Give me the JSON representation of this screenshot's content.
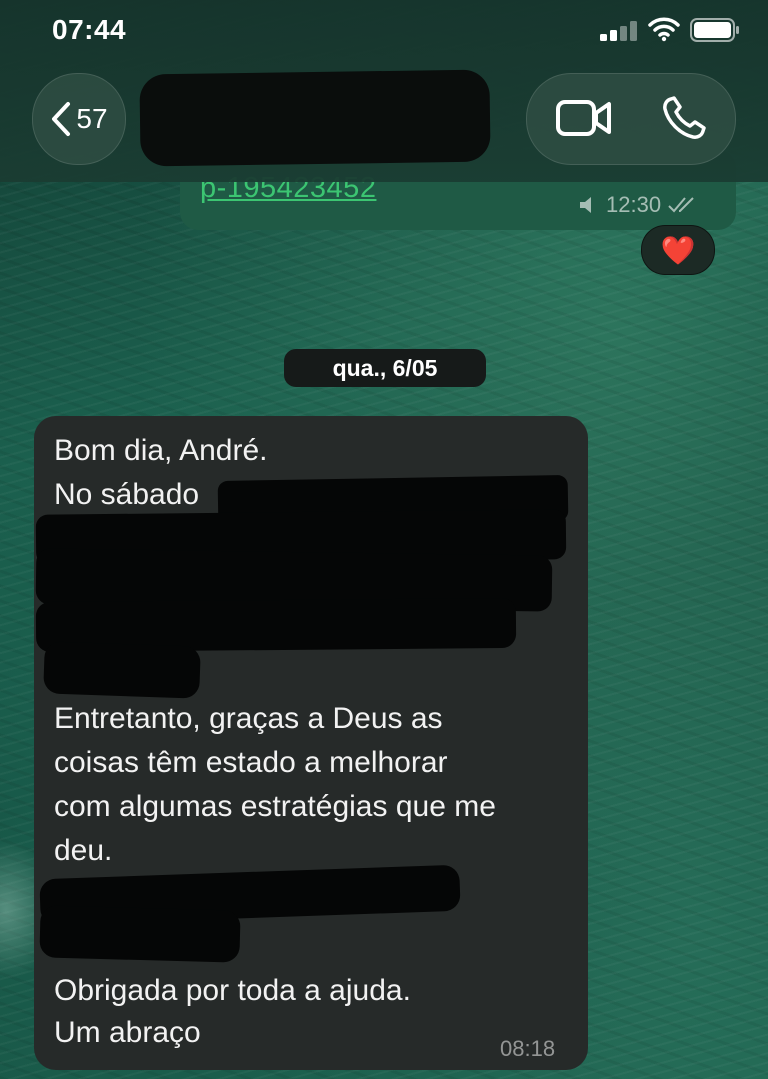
{
  "status_bar": {
    "time": "07:44"
  },
  "header": {
    "back_count": "57"
  },
  "previous_message": {
    "link_text": "p-195423452",
    "time": "12:30",
    "reaction": "❤️"
  },
  "date_chip": "qua., 6/05",
  "message": {
    "lines": [
      "Bom dia, André.",
      "No sábado",
      "Entretanto, graças a Deus as",
      "coisas têm estado a melhorar",
      "com algumas estratégias que me",
      "deu.",
      "Obrigada por toda a ajuda.",
      "Um abraço"
    ],
    "time": "08:18"
  },
  "colors": {
    "link": "#3cc572",
    "incoming_bubble": "#262a29",
    "outgoing_bubble": "#1f5a45"
  }
}
